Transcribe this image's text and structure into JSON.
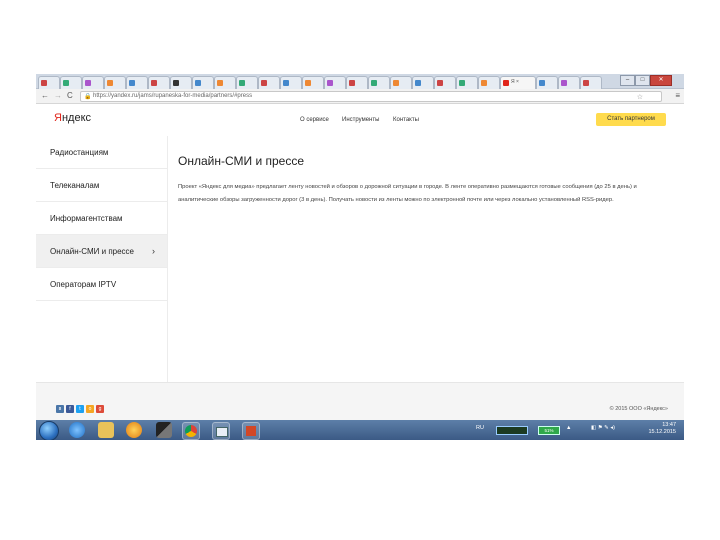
{
  "browser": {
    "url": "https://yandex.ru/jams/rupaneska-for-media/partners/#press",
    "window_controls": [
      "–",
      "□",
      "✕"
    ]
  },
  "header": {
    "logo_ya": "Я",
    "logo_rest": "ндекс",
    "nav": [
      "О сервисе",
      "Инструменты",
      "Контакты"
    ],
    "partner_button": "Стать партнером"
  },
  "sidebar": {
    "items": [
      {
        "label": "Радиостанциям"
      },
      {
        "label": "Телеканалам"
      },
      {
        "label": "Информагентствам"
      },
      {
        "label": "Онлайн-СМИ и прессе",
        "chevron": "›"
      },
      {
        "label": "Операторам IPTV"
      }
    ]
  },
  "main": {
    "title": "Онлайн-СМИ и прессе",
    "description": "Проект «Яндекс для медиа» предлагает ленту новостей и обзоров о дорожной ситуации в городе. В ленте оперативно размещаются готовые сообщения (до 25 в день) и аналитические обзоры загруженности дорог (3 в день). Получать новости из ленты можно по электронной почте или через локально установленный RSS-ридер."
  },
  "footer": {
    "social": [
      "в",
      "f",
      "t",
      "о",
      "g"
    ],
    "social_colors": [
      "#4a76a8",
      "#3b5998",
      "#1da1f2",
      "#f5a623",
      "#dd4b39"
    ],
    "copyright": "© 2015 ООО «Яндекс»"
  },
  "taskbar": {
    "battery": "51%",
    "tray_label": "RU",
    "time": "13:47",
    "date": "15.12.2015"
  }
}
